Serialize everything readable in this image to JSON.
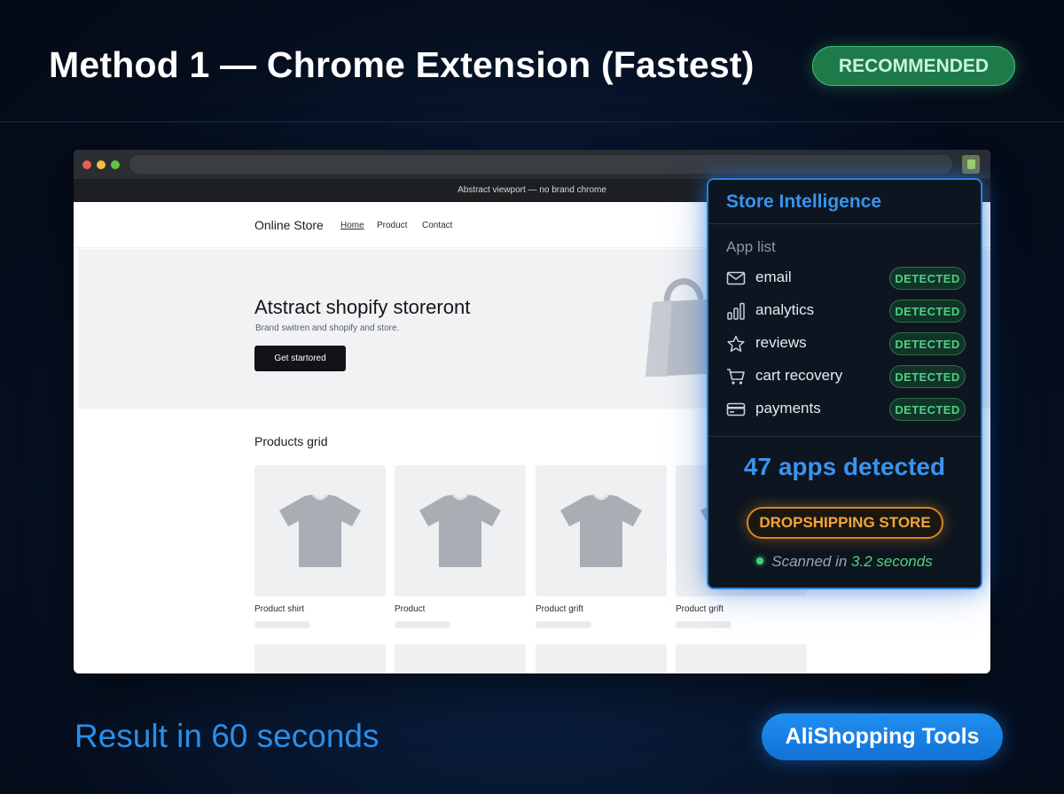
{
  "header": {
    "title": "Method 1 — Chrome Extension (Fastest)",
    "badge": "RECOMMENDED"
  },
  "browser": {
    "notice": "Abstract viewport — no brand chrome",
    "extension_icon": "shopify-bag-icon"
  },
  "site": {
    "store_name": "Online Store",
    "nav": [
      "Home",
      "Product",
      "Contact"
    ],
    "hero": {
      "title": "Atstract shopify storeront",
      "subtitle": "Brand swit­ren and shopify and store.",
      "button": "Get startored"
    },
    "grid_title": "Products grid",
    "products": [
      {
        "label": "Product shirt",
        "icon": "tshirt-icon"
      },
      {
        "label": "Product",
        "icon": "tshirt-icon"
      },
      {
        "label": "Product grift",
        "icon": "tshirt-icon"
      },
      {
        "label": "Product grift",
        "icon": "tshirt-icon"
      }
    ]
  },
  "panel": {
    "title": "Store Intelligence",
    "app_list_label": "App list",
    "apps": [
      {
        "name": "email",
        "icon": "mail-icon",
        "status": "DETECTED"
      },
      {
        "name": "analytics",
        "icon": "bar-chart-icon",
        "status": "DETECTED"
      },
      {
        "name": "reviews",
        "icon": "star-icon",
        "status": "DETECTED"
      },
      {
        "name": "cart recovery",
        "icon": "cart-icon",
        "status": "DETECTED"
      },
      {
        "name": "payments",
        "icon": "credit-card-icon",
        "status": "DETECTED"
      }
    ],
    "apps_detected": "47 apps detected",
    "store_type": "DROPSHIPPING STORE",
    "scan_prefix": "Scanned in ",
    "scan_time": "3.2 seconds"
  },
  "footer": {
    "result": "Result in 60 seconds",
    "brand": "AliShopping Tools"
  },
  "colors": {
    "accent_blue": "#3a93ee",
    "detected_green": "#4fd08a",
    "dropship_orange": "#f3a43c",
    "recommended_green": "#1f7a4a"
  }
}
